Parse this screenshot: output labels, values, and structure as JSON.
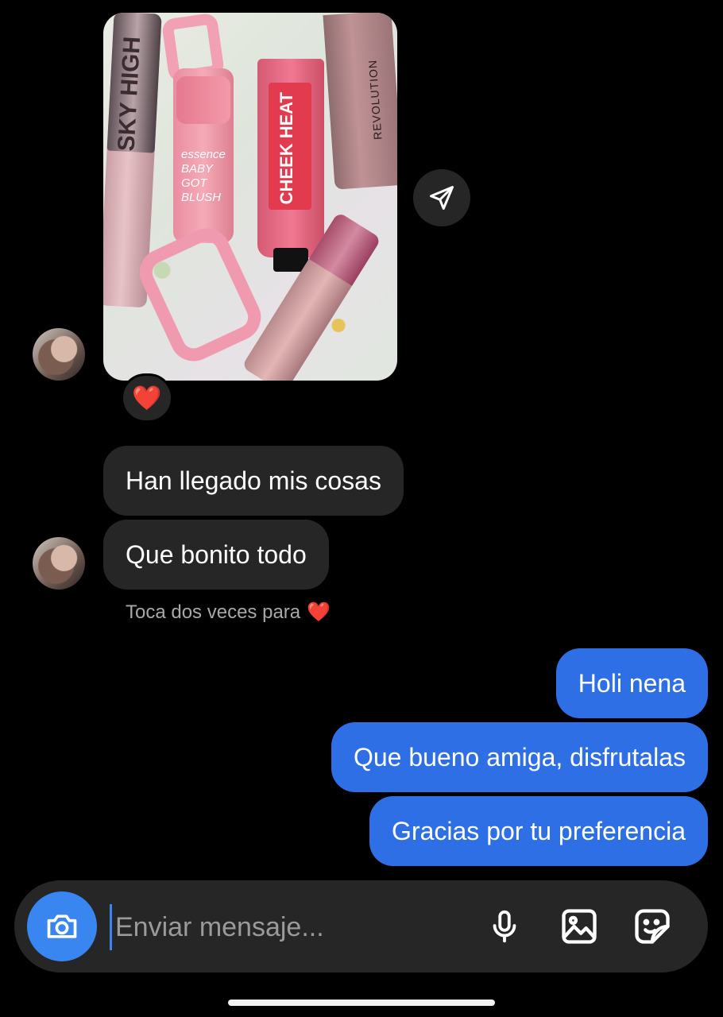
{
  "messages_in": [
    {
      "text": "Han llegado mis cosas"
    },
    {
      "text": "Que bonito todo"
    }
  ],
  "hint": {
    "text": "Toca dos veces para",
    "emoji": "❤️"
  },
  "reaction": {
    "emoji": "❤️"
  },
  "messages_out": [
    {
      "text": "Holi nena"
    },
    {
      "text": "Que bueno amiga, disfrutalas"
    },
    {
      "text": "Gracias por tu preferencia"
    }
  ],
  "photo": {
    "mascara_text": "SKY HIGH",
    "blush_stick_text": [
      "essence",
      "BABY",
      "GOT",
      "BLUSH"
    ],
    "tube_text": "CHEEK HEAT",
    "bottle_text": "REVOLUTION"
  },
  "composer": {
    "placeholder": "Enviar mensaje..."
  },
  "colors": {
    "outgoing": "#2f6fe6",
    "incoming": "#262626",
    "camera": "#3a86f0"
  },
  "icons": [
    "share-icon",
    "camera-icon",
    "microphone-icon",
    "gallery-icon",
    "sticker-icon"
  ]
}
